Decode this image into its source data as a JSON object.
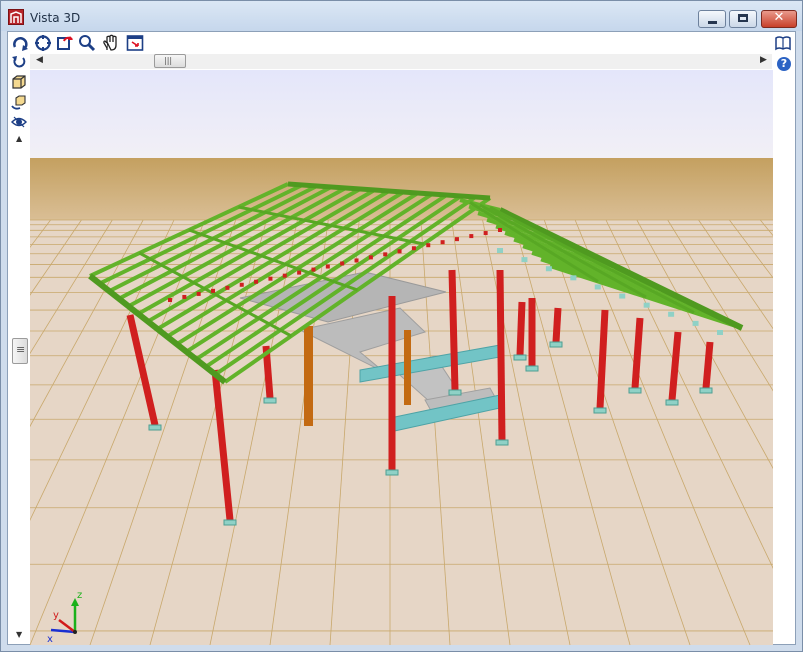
{
  "window": {
    "title": "Vista 3D",
    "buttons": {
      "minimize": "minimize",
      "maximize": "maximize",
      "close": "✕"
    }
  },
  "toolbar": {
    "tools": [
      {
        "icon": "rotate-view-icon",
        "label": ""
      },
      {
        "icon": "zoom-extents-icon",
        "label": ""
      },
      {
        "icon": "refresh-view-icon",
        "label": ""
      },
      {
        "icon": "zoom-window-icon",
        "label": ""
      },
      {
        "icon": "pan-hand-icon",
        "label": ""
      },
      {
        "icon": "select-window-icon",
        "label": ""
      }
    ],
    "right_tools": [
      {
        "icon": "book-icon"
      },
      {
        "icon": "help-icon",
        "label": "?"
      }
    ]
  },
  "side_tools": [
    {
      "icon": "undo-rotate-icon"
    },
    {
      "icon": "cube-view-icon"
    },
    {
      "icon": "cube-rotate-icon"
    },
    {
      "icon": "eye-visibility-icon"
    }
  ],
  "scrollbar": {
    "grip": "|||",
    "vgrip": "≡"
  },
  "axes": {
    "x": "x",
    "y": "y",
    "z": "z"
  },
  "colors": {
    "sky_top": "#e4e6fa",
    "sky_bottom": "#f2f0f6",
    "horizon": "#c9a664",
    "floor": "#e6d6c6",
    "grid": "#c8a86c",
    "column": "#d01f1f",
    "roof_beam": "#62b32a",
    "slab": "#b4b4b4",
    "cyan_beam": "#6ec3c6",
    "wood_column": "#c36a12"
  }
}
